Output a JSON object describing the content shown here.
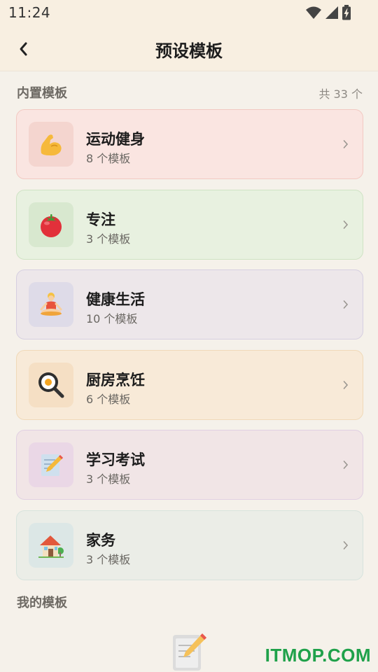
{
  "status_bar": {
    "time": "11:24",
    "icons": [
      "wifi-icon",
      "signal-icon",
      "battery-charging-icon"
    ]
  },
  "header": {
    "title": "预设模板",
    "back_icon": "chevron-left-icon"
  },
  "builtin_section": {
    "title": "内置模板",
    "count_label": "共 33 个"
  },
  "unit_label": "个模板",
  "categories": [
    {
      "name": "运动健身",
      "count": "8",
      "icon": "flexed-biceps-icon",
      "bg": "#fae5e1",
      "border": "#f2c9c2",
      "icon_bg": "#f4d5cf"
    },
    {
      "name": "专注",
      "count": "3",
      "icon": "tomato-icon",
      "bg": "#e8f1e0",
      "border": "#cfe3c4",
      "icon_bg": "#d8e8cf"
    },
    {
      "name": "健康生活",
      "count": "10",
      "icon": "meditation-person-icon",
      "bg": "#ede7ea",
      "border": "#d6cfe0",
      "icon_bg": "#dedbe8"
    },
    {
      "name": "厨房烹饪",
      "count": "6",
      "icon": "frying-pan-egg-icon",
      "bg": "#f8ead8",
      "border": "#f0d9b8",
      "icon_bg": "#f5dfc4"
    },
    {
      "name": "学习考试",
      "count": "3",
      "icon": "memo-pencil-icon",
      "bg": "#f1e5e6",
      "border": "#e1d0e2",
      "icon_bg": "#ead7e6"
    },
    {
      "name": "家务",
      "count": "3",
      "icon": "house-garden-icon",
      "bg": "#ebede7",
      "border": "#d7e3dd",
      "icon_bg": "#dce7e6"
    }
  ],
  "my_section": {
    "title": "我的模板",
    "empty_icon": "memo-pencil-icon"
  },
  "watermark": "ITMOP.COM",
  "colors": {
    "status_bg": "#f8efe1",
    "page_bg": "#f5f1ea",
    "watermark": "#1fa14a"
  }
}
